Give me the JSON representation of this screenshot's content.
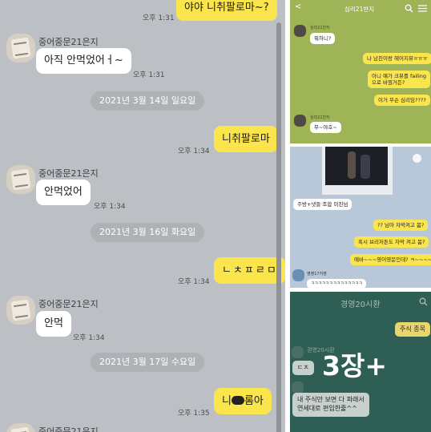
{
  "main": {
    "top_message": {
      "time": "오후 1:31",
      "text": "야야 니취팔로마~?"
    },
    "group1": {
      "sender": "중어중문21은지",
      "text": "아직 안먹었어ㅓ~",
      "time": "오후 1:31"
    },
    "date1": "2021년 3월 14일 일요일",
    "msg2": {
      "time": "오후 1:34",
      "text": "니취팔로마"
    },
    "group2": {
      "sender": "중어중문21은지",
      "text": "안먹었어",
      "time": "오후 1:34"
    },
    "date2": "2021년 3월 16일 화요일",
    "msg3": {
      "time": "오후 1:34",
      "text": "ㄴㅊㅍㄹㅁ"
    },
    "group3": {
      "sender": "중어중문21은지",
      "text": "안먹",
      "time": "오후 1:34"
    },
    "date3": "2021년 3월 17일 수요일",
    "msg4": {
      "time": "오후 1:35",
      "text_before": "니",
      "text_after": "롬아"
    },
    "group4": {
      "sender": "중어중문21은지"
    }
  },
  "thumb1": {
    "title": "심리21반지",
    "back": "<",
    "sender": "심리21반지",
    "msg1": "뭐하니?",
    "msg2": "나 남친이랑 헤어지뮤ㅠㅠㅠ",
    "msg3_line1": "아니 얘가 크뮤를 failing",
    "msg3_line2": "으로 바꿨거든?",
    "msg4": "이거 무슨 심리임????",
    "msg5": "무~야호~"
  },
  "thumb2": {
    "msg1": "주방+냇들 조합 미친넘",
    "msg2": "?? 님아 자막켜고 봄?",
    "msg3": "혹시 브리저튼도 자막 켜고 봄?",
    "msg4": "에바~~~영어영문인데? ㅋ~~~~",
    "sender": "영영17지영",
    "msg5": "ㅋㅋㅋㅋㅋㅋㅋㅋㅋㅋㅋㅋㅋㅋ"
  },
  "thumb3": {
    "title": "경영20시환",
    "msg1": "주식 종목",
    "sender": "경영20시환",
    "msg2": "ㄷㅊ",
    "overlay": "3장+",
    "msg3_line1": "내 주식만 보면 다 파래서",
    "msg3_line2": "연세대로 편입한줄^^"
  },
  "colors": {
    "chat_bg": "#bcc0c4",
    "my_bubble": "#fbe54d",
    "other_bubble": "#ffffff",
    "date_chip": "#aeb2b6"
  }
}
